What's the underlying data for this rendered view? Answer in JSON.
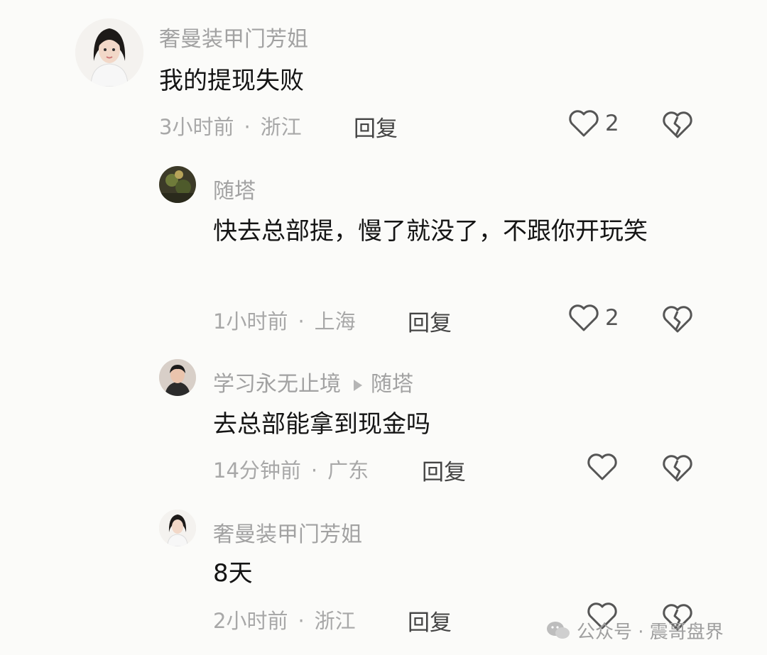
{
  "comments": [
    {
      "username": "奢曼装甲门芳姐",
      "text": "我的提现失败",
      "time": "3小时前",
      "location": "浙江",
      "reply_label": "回复",
      "likes": "2"
    },
    {
      "username": "随塔",
      "text": "快去总部提，慢了就没了，不跟你开玩笑",
      "time": "1小时前",
      "location": "上海",
      "reply_label": "回复",
      "likes": "2"
    },
    {
      "username": "学习永无止境",
      "reply_to": "随塔",
      "text": "去总部能拿到现金吗",
      "time": "14分钟前",
      "location": "广东",
      "reply_label": "回复",
      "likes": ""
    },
    {
      "username": "奢曼装甲门芳姐",
      "text": "8天",
      "time": "2小时前",
      "location": "浙江",
      "reply_label": "回复",
      "likes": ""
    }
  ],
  "watermark": {
    "text": "公众号 · 震哥盘界",
    "icon": "wechat-icon"
  },
  "icons": {
    "like": "heart-outline-icon",
    "dislike": "broken-heart-icon"
  }
}
